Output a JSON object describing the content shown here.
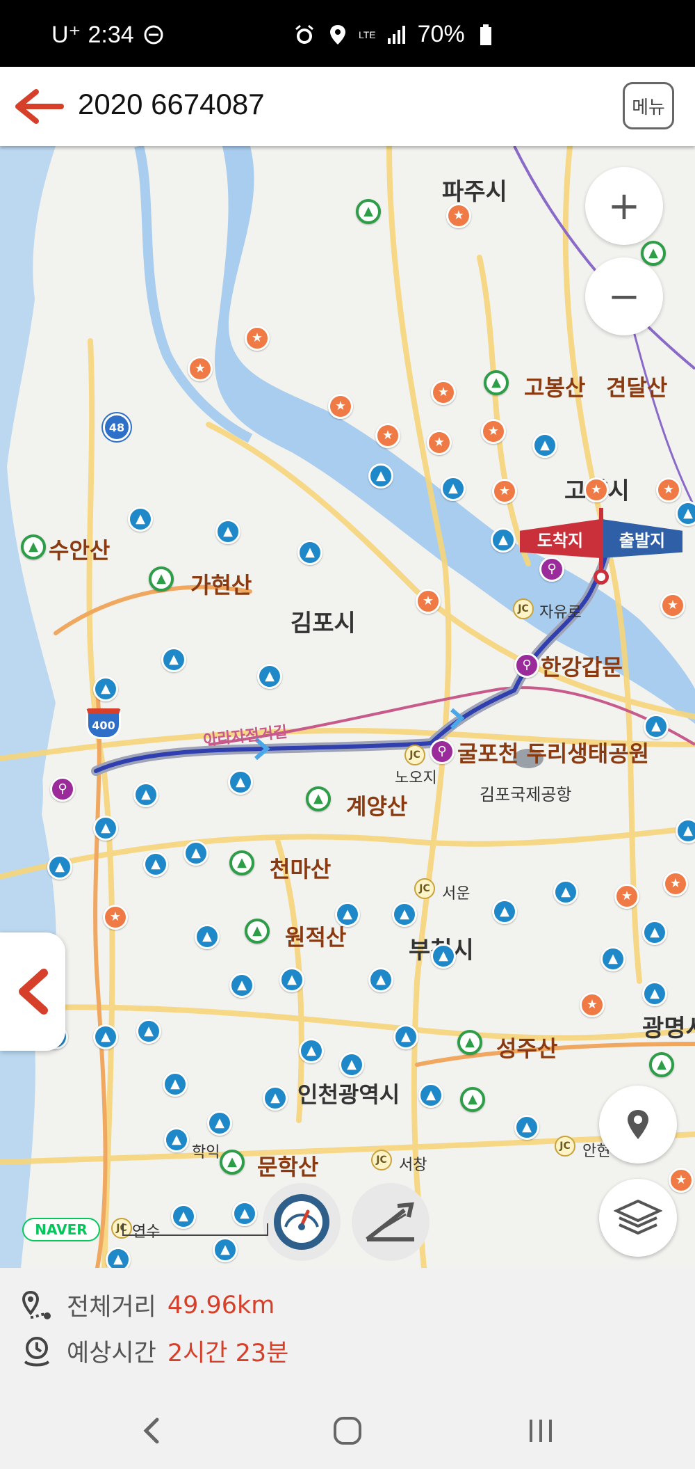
{
  "status_bar": {
    "carrier": "U⁺",
    "time": "2:34",
    "network": "LTE",
    "battery": "70%",
    "icons": [
      "dnd-icon",
      "alarm-icon",
      "location-icon",
      "lte-icon",
      "signal-icon",
      "battery-icon"
    ]
  },
  "header": {
    "title": "2020 6674087",
    "menu_label": "메뉴",
    "back_color": "#d6402a"
  },
  "map": {
    "places": {
      "paju": "파주시",
      "goyang": "고양시",
      "gimpo": "김포시",
      "bucheon": "부천시",
      "incheon": "인천광역시",
      "gwangmyeong": "광명시"
    },
    "mountains": {
      "suansan": "수안산",
      "gahyeonsan": "가현산",
      "gyeyangsan": "계양산",
      "cheonmasan": "천마산",
      "wonjeoksan": "원적산",
      "seongjusan": "성주산",
      "munhaksan": "문학산",
      "gobongsan": "고봉산",
      "gyeondalsan": "견달산"
    },
    "pois": {
      "hangang_gate": "한강갑문",
      "gulpocheon": "굴포천 두리생태공원",
      "gimpo_airport": "김포국제공항",
      "trail": "아라자전거길",
      "nooji": "노오지",
      "jayuro": "자유로",
      "seoun": "서운",
      "seochang": "서창",
      "anhyeon": "안현",
      "hakik": "학익",
      "yeonsu": "연수"
    },
    "highways": [
      "48",
      "400"
    ],
    "flag_arrive": "도착지",
    "flag_depart": "출발지",
    "naver_logo": "NAVER",
    "route_color": "#2f3fb0"
  },
  "summary": {
    "distance_label": "전체거리",
    "distance_value": "49.96km",
    "time_label": "예상시간",
    "time_value": "2시간 23분"
  }
}
